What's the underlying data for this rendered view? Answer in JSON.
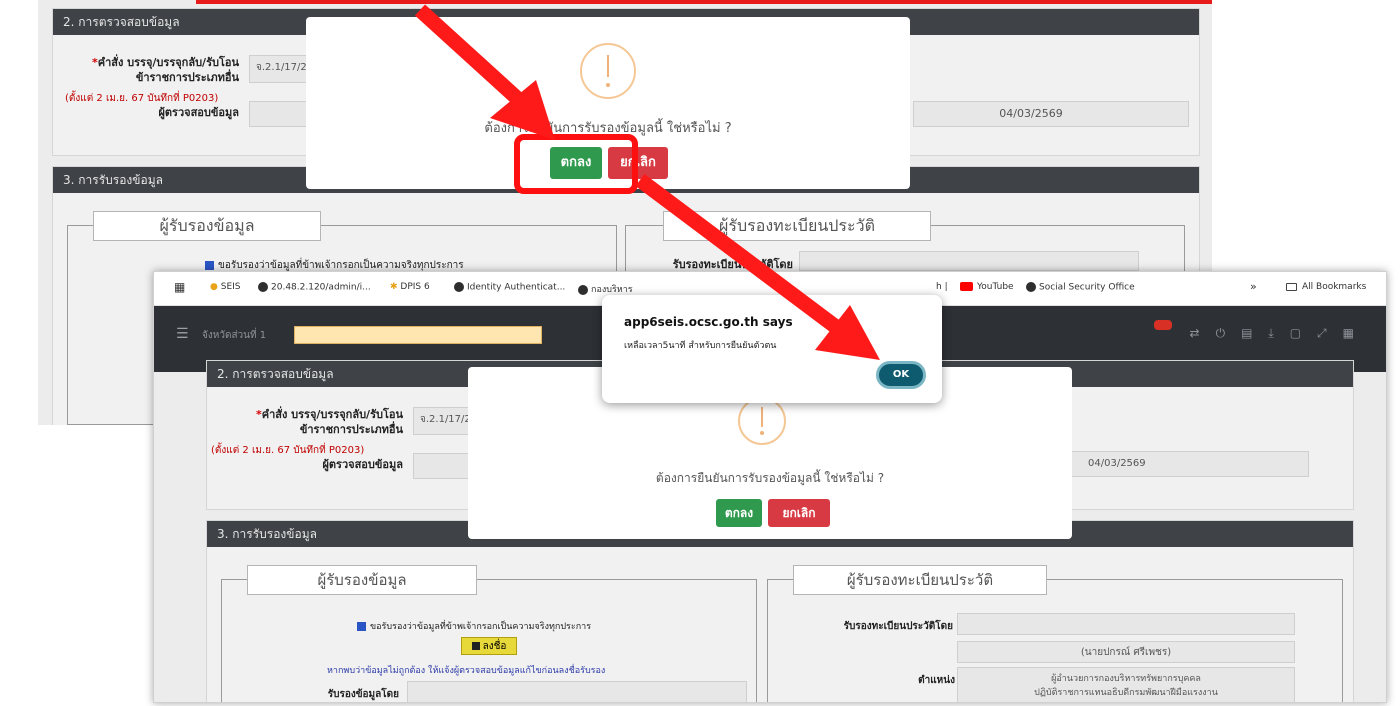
{
  "back": {
    "section2_title": "2. การตรวจสอบข้อมูล",
    "order_label_star": "*",
    "order_label_l1": "คำสั่ง บรรจุ/บรรจุกลับ/รับโอน",
    "order_label_l2": "ข้าราชการประเภทอื่น",
    "order_note": "(ตั้งแต่ 2 เม.ย. 67 บันทึกที่ P0203)",
    "order_value": "จ.2.1/17/2",
    "checker_label": "ผู้ตรวจสอบข้อมูล",
    "date_value": "04/03/2569",
    "section3_title": "3. การรับรองข้อมูล",
    "certifier_legend": "ผู้รับรองข้อมูล",
    "registry_legend": "ผู้รับรองทะเบียนประวัติ",
    "certify_check": "ขอรับรองว่าข้อมูลที่ข้าพเจ้ากรอกเป็นความจริงทุกประการ",
    "registry_by_label": "รับรองทะเบียนประวัติโดย",
    "modal_question": "ต้องการยืนยันการรับรองข้อมูลนี้ ใช่หรือไม่ ?",
    "ok_label": "ตกลง",
    "cancel_label": "ยกเลิก"
  },
  "front": {
    "bookmarks": [
      {
        "label": "SEIS"
      },
      {
        "label": "20.48.2.120/admin/i..."
      },
      {
        "label": "DPIS 6"
      },
      {
        "label": "Identity Authenticat..."
      },
      {
        "label": "กองบริหาร"
      },
      {
        "label": "h |"
      },
      {
        "label": "YouTube"
      },
      {
        "label": "Social Security Office"
      }
    ],
    "more_bookmarks": "»",
    "all_bookmarks": "All Bookmarks",
    "dept_label": "จังหวัดส่วนที่ 1",
    "section2_title": "2. การตรวจสอบข้อมูล",
    "order_label_star": "*",
    "order_label_l1": "คำสั่ง บรรจุ/บรรจุกลับ/รับโอน",
    "order_label_l2": "ข้าราชการประเภทอื่น",
    "order_note": "(ตั้งแต่ 2 เม.ย. 67 บันทึกที่ P0203)",
    "order_value": "จ.2.1/17/2",
    "checker_label": "ผู้ตรวจสอบข้อมูล",
    "date_value": "04/03/2569",
    "section3_title": "3. การรับรองข้อมูล",
    "certifier_legend": "ผู้รับรองข้อมูล",
    "registry_legend": "ผู้รับรองทะเบียนประวัติ",
    "certify_check": "ขอรับรองว่าข้อมูลที่ข้าพเจ้ากรอกเป็นความจริงทุกประการ",
    "sign_button": "ลงชื่อ",
    "notify_text": "หากพบว่าข้อมูลไม่ถูกต้อง ให้แจ้งผู้ตรวจสอบข้อมูลแก้ไขก่อนลงชื่อรับรอง",
    "certified_by_label": "รับรองข้อมูลโดย",
    "registry_by_label": "รับรองทะเบียนประวัติโดย",
    "registry_person": "(นายปกรณ์  ศรีเพชร)",
    "position_label": "ตำแหน่ง",
    "position_l1": "ผู้อำนวยการกองบริหารทรัพยากรบุคคล",
    "position_l2": "ปฏิบัติราชการแทนอธิบดีกรมพัฒนาฝีมือแรงงาน",
    "modal_question": "ต้องการยืนยันการรับรองข้อมูลนี้ ใช่หรือไม่ ?",
    "ok_label": "ตกลง",
    "cancel_label": "ยกเลิก"
  },
  "alert": {
    "title": "app6seis.ocsc.go.th says",
    "message": "เหลือเวลา5นาที สำหรับการยืนยันตัวตน",
    "ok": "OK"
  },
  "colors": {
    "header_dark": "#3f4246",
    "ok_green": "#2f9a4d",
    "cancel_red": "#d83a43",
    "annotation_red": "#ff1010",
    "alert_ok": "#0e5a6e"
  }
}
